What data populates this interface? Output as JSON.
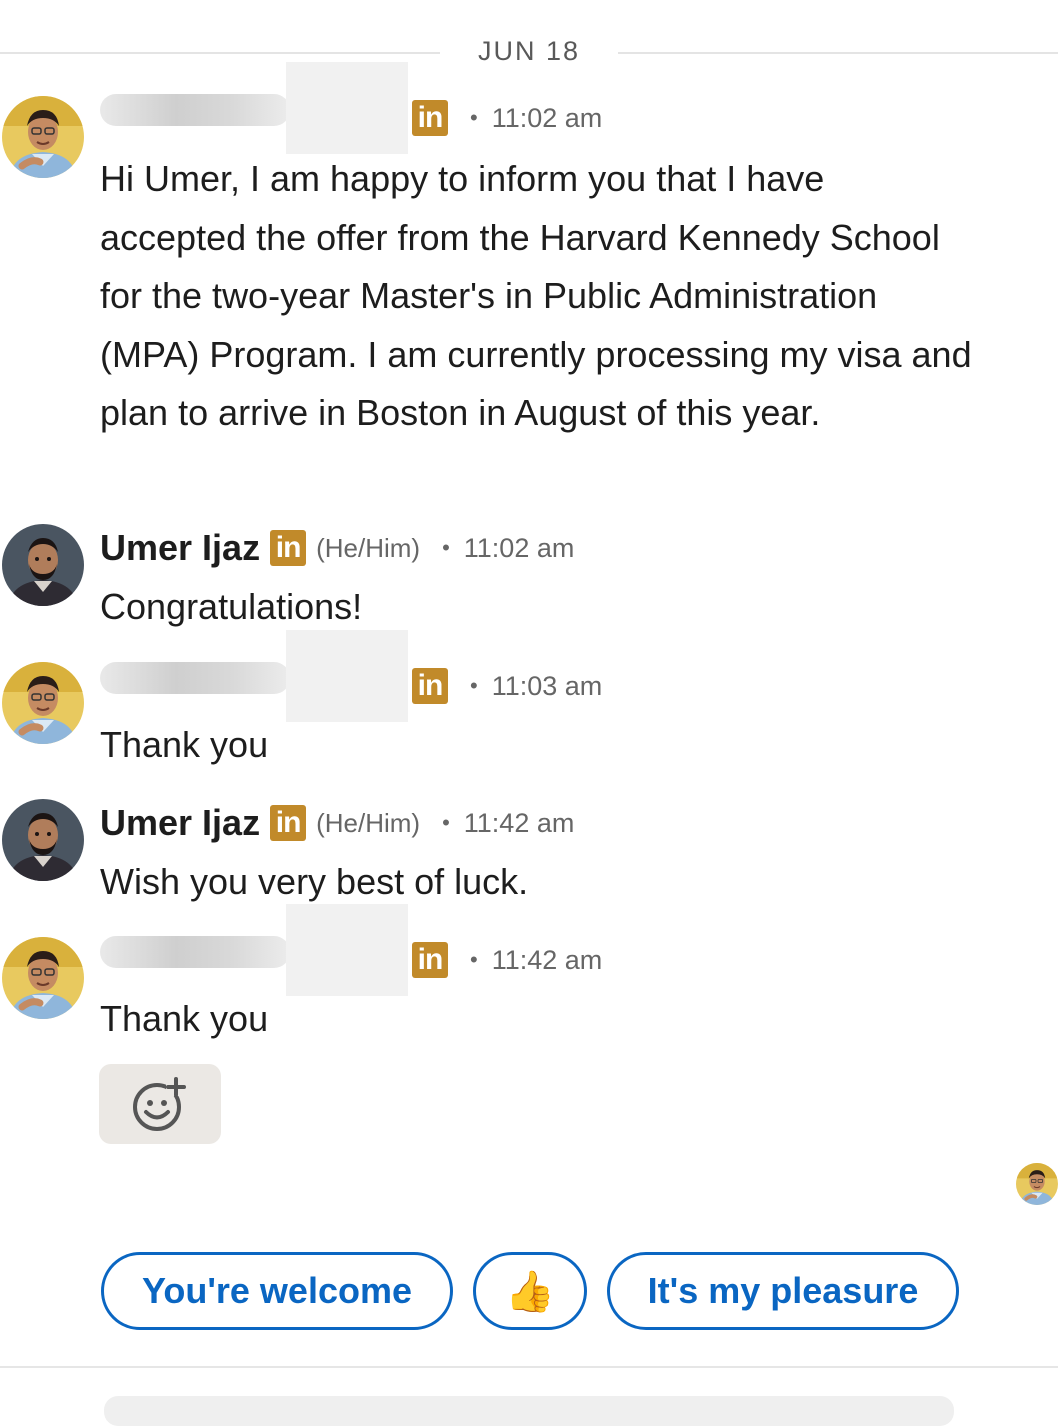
{
  "date_separator": "JUN 18",
  "linkedin_badge": "in",
  "separator_dot": "•",
  "messages": [
    {
      "sender": "",
      "time": "11:02 am",
      "body": "Hi Umer, I am happy to inform you that I have accepted the offer from the Harvard Kennedy School for the two-year Master's in Public Administration (MPA) Program. I am currently processing my visa and plan to arrive in Boston in August of this year."
    },
    {
      "sender": "Umer Ijaz",
      "pronouns": "(He/Him)",
      "time": "11:02 am",
      "body": "Congratulations!"
    },
    {
      "sender": "",
      "time": "11:03 am",
      "body": "Thank you"
    },
    {
      "sender": "Umer Ijaz",
      "pronouns": "(He/Him)",
      "time": "11:42 am",
      "body": "Wish you very best of luck."
    },
    {
      "sender": "",
      "time": "11:42 am",
      "body": "Thank you"
    }
  ],
  "smart_replies": [
    "You're welcome",
    "👍",
    "It's my pleasure"
  ],
  "colors": {
    "linkedin_gold": "#c18a2a",
    "linkedin_blue": "#0a66c2"
  },
  "icons": {
    "add_reaction": "add-reaction-icon",
    "read_receipt": "read-receipt-avatar"
  }
}
